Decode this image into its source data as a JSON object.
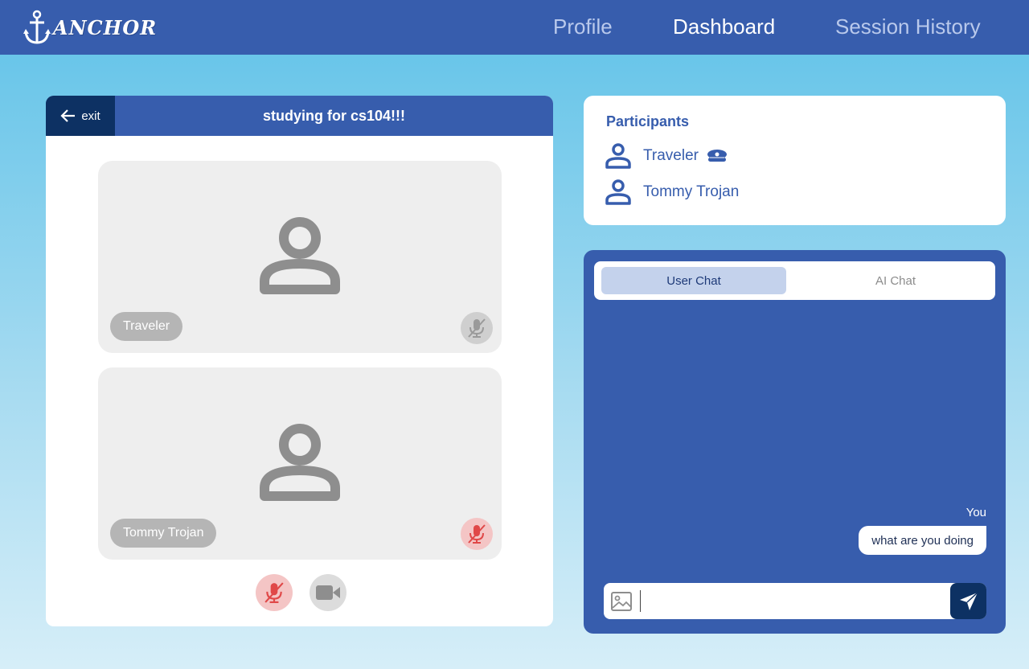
{
  "app": {
    "logo_text": "ANCHOR",
    "nav": [
      {
        "label": "Profile",
        "active": false
      },
      {
        "label": "Dashboard",
        "active": true
      },
      {
        "label": "Session History",
        "active": false
      }
    ]
  },
  "session": {
    "exit_label": "exit",
    "title": "studying for cs104!!!",
    "tiles": [
      {
        "name": "Traveler",
        "mic_state": "muted",
        "mic_color": "#9a9a9a"
      },
      {
        "name": "Tommy Trojan",
        "mic_state": "muted",
        "mic_color": "#e04848"
      }
    ],
    "controls": {
      "mic": "muted",
      "camera": "on"
    }
  },
  "participants": {
    "title": "Participants",
    "list": [
      {
        "name": "Traveler",
        "host_icon": "captain-hat-icon"
      },
      {
        "name": "Tommy Trojan"
      }
    ]
  },
  "chat": {
    "tabs": [
      {
        "label": "User Chat",
        "active": true
      },
      {
        "label": "AI Chat",
        "active": false
      }
    ],
    "messages": [
      {
        "sender": "You",
        "text": "what are you doing"
      }
    ],
    "input_value": "",
    "input_placeholder": ""
  },
  "colors": {
    "brand": "#375dad",
    "dark": "#0d3163",
    "muted_red": "#e04848"
  }
}
